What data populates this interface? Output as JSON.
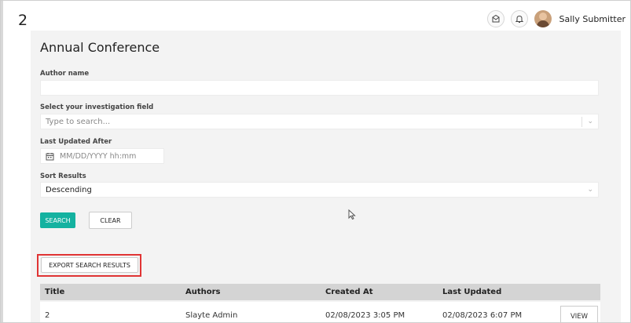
{
  "header": {
    "counter": "2",
    "user_name": "Sally Submitter",
    "icons": [
      "inbox-icon",
      "bell-icon"
    ]
  },
  "page": {
    "title": "Annual Conference"
  },
  "form": {
    "author_label": "Author name",
    "author_value": "",
    "field_label": "Select your investigation field",
    "field_placeholder": "Type to search...",
    "date_label": "Last Updated After",
    "date_placeholder": "MM/DD/YYYY hh:mm",
    "sort_label": "Sort Results",
    "sort_value": "Descending"
  },
  "actions": {
    "search": "SEARCH",
    "clear": "CLEAR",
    "export": "EXPORT SEARCH RESULTS"
  },
  "table": {
    "columns": [
      "Title",
      "Authors",
      "Created At",
      "Last Updated"
    ],
    "rows": [
      {
        "title": "2",
        "authors": "Slayte Admin",
        "created": "02/08/2023 3:05 PM",
        "updated": "02/08/2023 6:07 PM",
        "action": "VIEW"
      }
    ]
  },
  "colors": {
    "accent": "#14b2a0",
    "highlight": "#e03434"
  }
}
